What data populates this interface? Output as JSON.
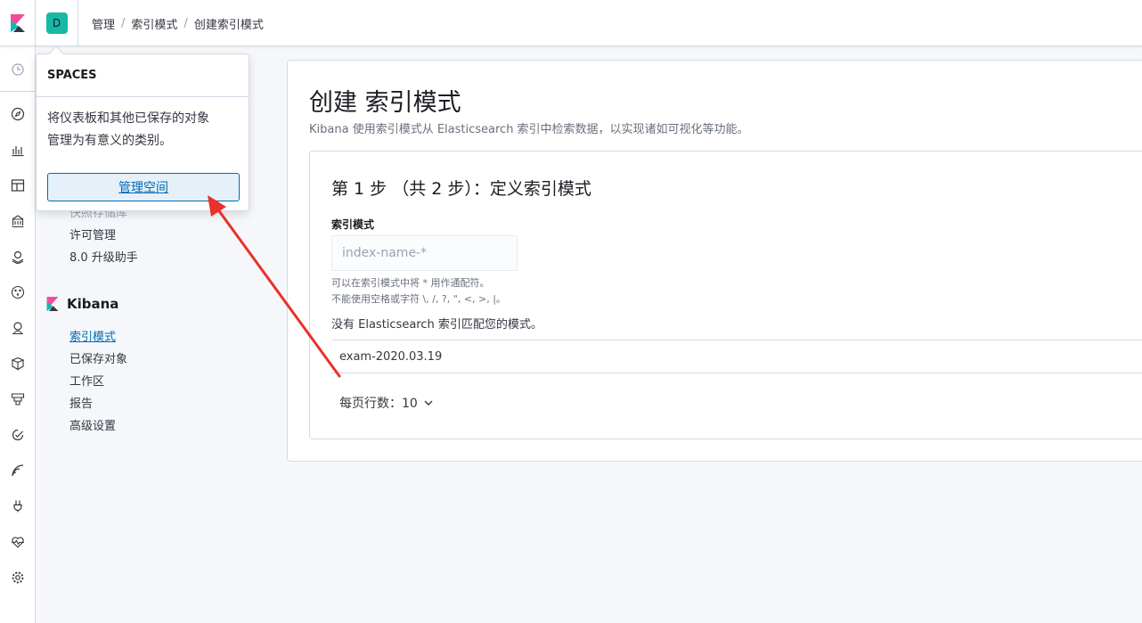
{
  "header": {
    "space_initial": "D",
    "breadcrumbs": [
      "管理",
      "创建索引模式"
    ],
    "breadcrumb_mid": "索引模式"
  },
  "popover": {
    "title": "SPACES",
    "body_line1": "将仪表板和其他已保存的对象",
    "body_line2": "管理为有意义的类别。",
    "manage_button": "管理空间"
  },
  "sidenav": {
    "faded_item": "快照存储库",
    "es_items": [
      "许可管理",
      "8.0 升级助手"
    ],
    "kibana_title": "Kibana",
    "kibana_items": [
      "索引模式",
      "已保存对象",
      "工作区",
      "报告",
      "高级设置"
    ]
  },
  "main": {
    "title": "创建 索引模式",
    "description": "Kibana 使用索引模式从 Elasticsearch 索引中检索数据，以实现诸如可视化等功能。",
    "step_title": "第 1 步 （共 2 步）：定义索引模式",
    "field_label": "索引模式",
    "input_placeholder": "index-name-*",
    "help_line1": "可以在索引模式中将 * 用作通配符。",
    "help_line2": "不能使用空格或字符 \\, /, ?, \", <, >, |。",
    "no_match": "没有 Elasticsearch 索引匹配您的模式。",
    "index_row": "exam-2020.03.19",
    "rows_per_page": "每页行数：10"
  },
  "colors": {
    "accent": "#006bb4",
    "space_avatar": "#17b8a6",
    "annotation_arrow": "#e8312a"
  }
}
